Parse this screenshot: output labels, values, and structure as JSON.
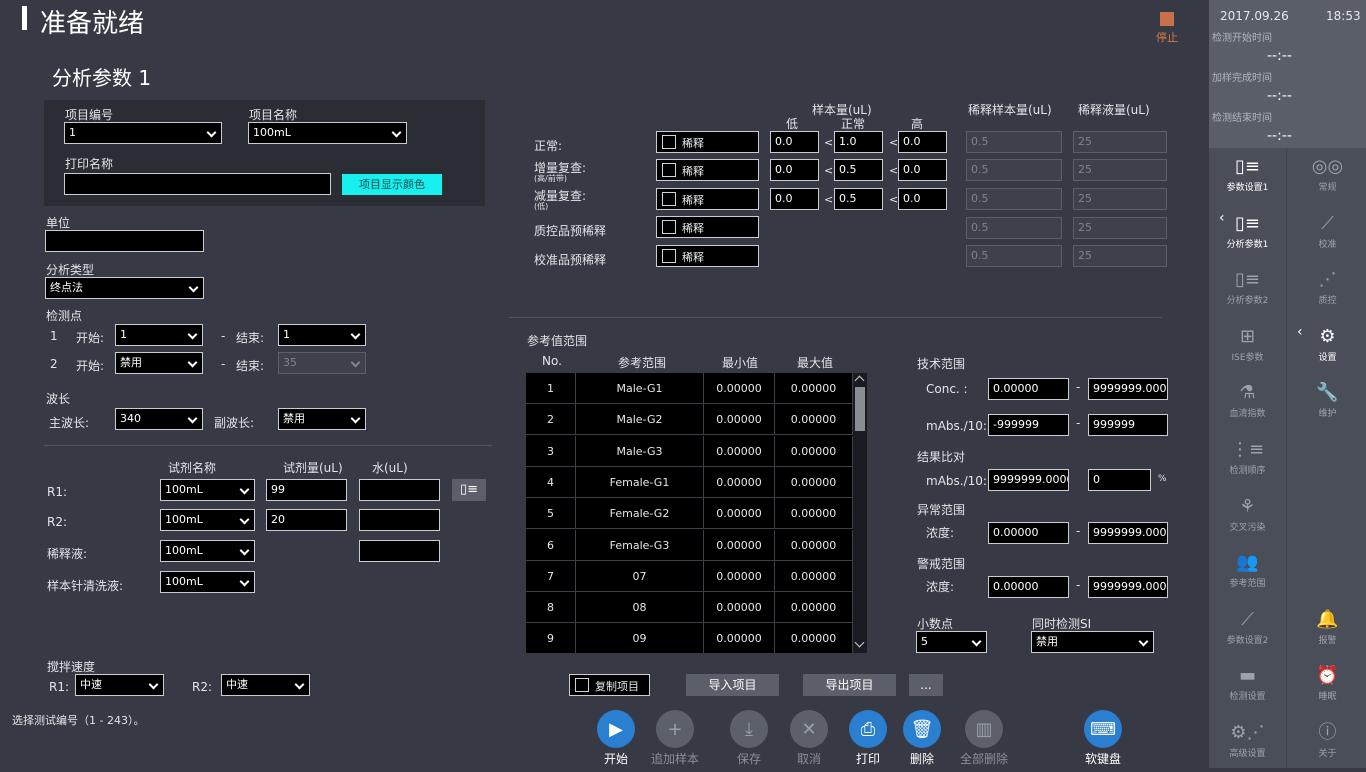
{
  "header": {
    "title": "准备就绪",
    "stop_label": "停止"
  },
  "section_title": "分析参数 1",
  "project": {
    "id_label": "项目编号",
    "id_value": "1",
    "name_label": "项目名称",
    "name_value": "100mL",
    "print_label": "打印名称",
    "print_value": "",
    "color_button": "项目显示颜色"
  },
  "unit": {
    "label": "单位",
    "value": ""
  },
  "analysis_type": {
    "label": "分析类型",
    "value": "终点法"
  },
  "detection": {
    "label": "检测点",
    "rows": [
      {
        "no": "1",
        "start_label": "开始:",
        "start": "1",
        "dash": "-",
        "end_label": "结束:",
        "end": "1"
      },
      {
        "no": "2",
        "start_label": "开始:",
        "start": "禁用",
        "dash": "-",
        "end_label": "结束:",
        "end": "35"
      }
    ]
  },
  "wavelength": {
    "label": "波长",
    "main_label": "主波长:",
    "main": "340",
    "sub_label": "副波长:",
    "sub": "禁用"
  },
  "reagent": {
    "col_name": "试剂名称",
    "col_amount": "试剂量(uL)",
    "col_water": "水(uL)",
    "rows": [
      {
        "label": "R1:",
        "name": "100mL",
        "amount": "99",
        "water": ""
      },
      {
        "label": "R2:",
        "name": "100mL",
        "amount": "20",
        "water": ""
      },
      {
        "label": "稀释液:",
        "name": "100mL",
        "water": ""
      },
      {
        "label": "样本针清洗液:",
        "name": "100mL"
      }
    ]
  },
  "stir": {
    "label": "搅拌速度",
    "r1_label": "R1:",
    "r1": "中速",
    "r2_label": "R2:",
    "r2": "中速"
  },
  "status_text": "选择测试编号（1 - 243）。",
  "sample": {
    "col_sample": "样本量(uL)",
    "col_low": "低",
    "col_normal": "正常",
    "col_high": "高",
    "col_dil_sample": "稀释样本量(uL)",
    "col_dil_liquid": "稀释液量(uL)",
    "lt": "<",
    "rows": [
      {
        "label": "正常:",
        "sub": "",
        "dilute": "稀释",
        "low": "0.0",
        "normal": "1.0",
        "high": "0.0",
        "ds": "0.5",
        "dl": "25"
      },
      {
        "label": "增量复查:",
        "sub": "(高/前带)",
        "dilute": "稀释",
        "low": "0.0",
        "normal": "0.5",
        "high": "0.0",
        "ds": "0.5",
        "dl": "25"
      },
      {
        "label": "减量复查:",
        "sub": "(低)",
        "dilute": "稀释",
        "low": "0.0",
        "normal": "0.5",
        "high": "0.0",
        "ds": "0.5",
        "dl": "25"
      },
      {
        "label": "质控品预稀释",
        "sub": "",
        "dilute": "稀释",
        "ds": "0.5",
        "dl": "25"
      },
      {
        "label": "校准品预稀释",
        "sub": "",
        "dilute": "稀释",
        "ds": "0.5",
        "dl": "25"
      }
    ]
  },
  "reference": {
    "label": "参考值范围",
    "headers": [
      "No.",
      "参考范围",
      "最小值",
      "最大值"
    ],
    "rows": [
      [
        "1",
        "Male-G1",
        "0.00000",
        "0.00000"
      ],
      [
        "2",
        "Male-G2",
        "0.00000",
        "0.00000"
      ],
      [
        "3",
        "Male-G3",
        "0.00000",
        "0.00000"
      ],
      [
        "4",
        "Female-G1",
        "0.00000",
        "0.00000"
      ],
      [
        "5",
        "Female-G2",
        "0.00000",
        "0.00000"
      ],
      [
        "6",
        "Female-G3",
        "0.00000",
        "0.00000"
      ],
      [
        "7",
        "07",
        "0.00000",
        "0.00000"
      ],
      [
        "8",
        "08",
        "0.00000",
        "0.00000"
      ],
      [
        "9",
        "09",
        "0.00000",
        "0.00000"
      ]
    ]
  },
  "tech": {
    "label": "技术范围",
    "conc_label": "Conc. :",
    "conc_min": "0.00000",
    "conc_max": "9999999.00000",
    "mabs_label": "mAbs./10:",
    "mabs_min": "-999999",
    "mabs_max": "999999",
    "cmp_label": "结果比对",
    "cmp_mabs_label": "mAbs./10:",
    "cmp_value": "9999999.00000",
    "cmp_pct": "0",
    "pct": "%",
    "abn_label": "异常范围",
    "abn_conc_label": "浓度:",
    "abn_min": "0.00000",
    "abn_max": "9999999.00000",
    "warn_label": "警戒范围",
    "warn_conc_label": "浓度:",
    "warn_min": "0.00000",
    "warn_max": "9999999.00000",
    "dec_label": "小数点",
    "dec_value": "5",
    "si_label": "同时检测SI",
    "si_value": "禁用",
    "dash": "-"
  },
  "actions": {
    "copy": "复制项目",
    "import": "导入项目",
    "export": "导出项目",
    "more": "..."
  },
  "toolbar": {
    "start": "开始",
    "add_sample": "追加样本",
    "save": "保存",
    "cancel": "取消",
    "print": "打印",
    "delete": "删除",
    "delete_all": "全部删除",
    "keyboard": "软键盘"
  },
  "sidebar": {
    "date": "2017.09.26",
    "time": "18:53",
    "start_time_label": "检测开始时间",
    "start_time": "--:--",
    "add_done_label": "加样完成时间",
    "add_done": "--:--",
    "end_label": "检测结束时间",
    "end": "--:--",
    "items": [
      {
        "label": "参数设置1",
        "icon": "params-icon"
      },
      {
        "label": "常规",
        "icon": "routine-icon"
      },
      {
        "label": "分析参数1",
        "icon": "analysis-params-icon"
      },
      {
        "label": "校准",
        "icon": "calibration-icon"
      },
      {
        "label": "分析参数2",
        "icon": "analysis-params2-icon"
      },
      {
        "label": "质控",
        "icon": "qc-icon"
      },
      {
        "label": "ISE参数",
        "icon": "ise-icon"
      },
      {
        "label": "设置",
        "icon": "settings-icon"
      },
      {
        "label": "血清指数",
        "icon": "serum-index-icon"
      },
      {
        "label": "维护",
        "icon": "maintenance-icon"
      },
      {
        "label": "检测顺序",
        "icon": "order-icon"
      },
      {
        "label": "",
        "icon": "blank"
      },
      {
        "label": "交叉污染",
        "icon": "cross-contamination-icon"
      },
      {
        "label": "",
        "icon": "blank"
      },
      {
        "label": "参考范围",
        "icon": "reference-range-icon"
      },
      {
        "label": "",
        "icon": "blank"
      },
      {
        "label": "参数设置2",
        "icon": "params2-icon"
      },
      {
        "label": "报警",
        "icon": "alarm-icon"
      },
      {
        "label": "检测设置",
        "icon": "folder-icon"
      },
      {
        "label": "睡眠",
        "icon": "sleep-icon"
      },
      {
        "label": "高级设置",
        "icon": "advanced-icon"
      },
      {
        "label": "关于",
        "icon": "info-icon"
      }
    ]
  }
}
